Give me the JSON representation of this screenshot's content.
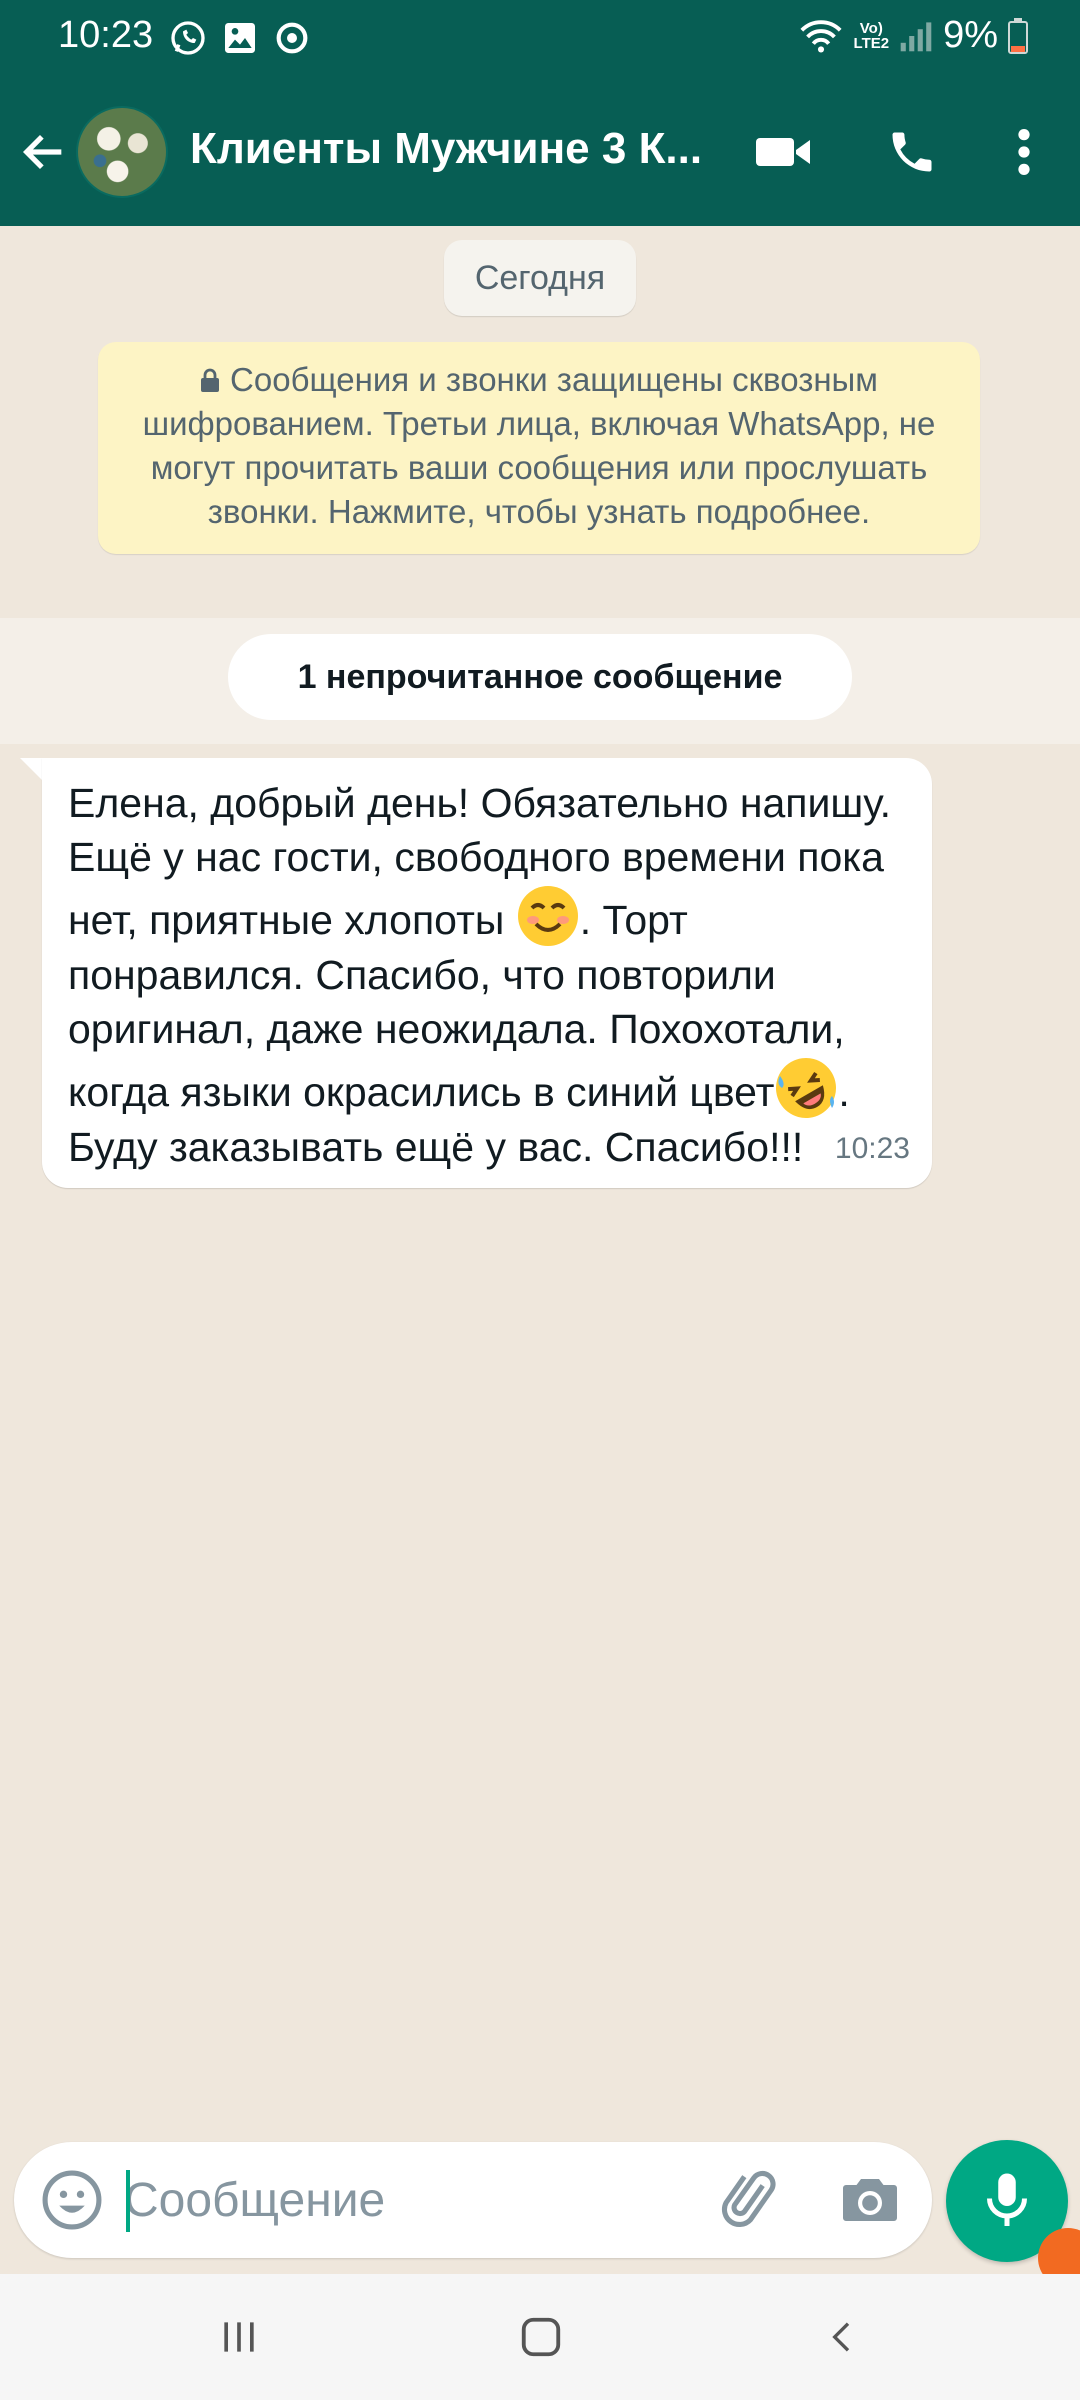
{
  "status_bar": {
    "time": "10:23",
    "network_top": "Vo)",
    "network_bottom": "LTE2",
    "battery": "9%",
    "icons": [
      "whatsapp-icon",
      "gallery-icon",
      "sync-icon",
      "wifi-icon",
      "signal-icon",
      "battery-icon"
    ]
  },
  "header": {
    "title": "Клиенты Мужчине 3 К...",
    "icons": [
      "back-arrow-icon",
      "video-call-icon",
      "phone-icon",
      "more-vert-icon"
    ]
  },
  "chat": {
    "date_chip": "Сегодня",
    "encryption_notice": "Сообщения и звонки защищены сквозным шифрованием. Третьи лица, включая WhatsApp, не могут прочитать ваши сообщения или прослушать звонки. Нажмите, чтобы узнать подробнее.",
    "unread_label": "1 непрочитанное сообщение",
    "message": {
      "part1": "Елена, добрый день! Обязательно напишу. Ещё у нас гости, свободного времени пока нет, приятные хлопоты ",
      "emoji1": "smiling-face-icon",
      "part2": ". Торт понравился. Спасибо, что повторили оригинал, даже неожидала. Похохотали, когда языки окрасились в синий цвет",
      "emoji2": "rolling-on-floor-laughing-icon",
      "part3": ". Буду заказывать ещё у вас. Спасибо!!!",
      "time": "10:23"
    }
  },
  "composer": {
    "placeholder": "Сообщение",
    "icons": [
      "emoji-icon",
      "attach-icon",
      "camera-icon",
      "mic-icon"
    ]
  },
  "colors": {
    "header": "#075e54",
    "accent": "#00a884",
    "chat_bg": "#efe7dc",
    "notice_bg": "#fdf4c5"
  },
  "nav": {
    "icons": [
      "recent-apps-icon",
      "home-icon",
      "back-icon"
    ]
  }
}
